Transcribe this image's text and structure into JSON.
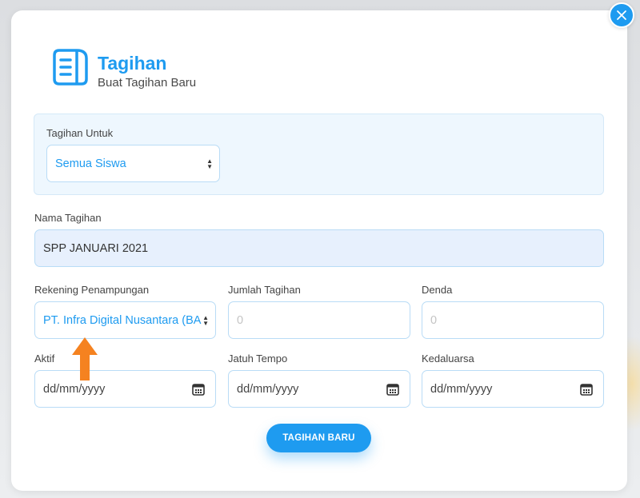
{
  "header": {
    "title": "Tagihan",
    "subtitle": "Buat Tagihan Baru",
    "icon": "document-icon"
  },
  "form": {
    "tagihan_untuk": {
      "label": "Tagihan Untuk",
      "value": "Semua Siswa"
    },
    "nama_tagihan": {
      "label": "Nama Tagihan",
      "value": "SPP JANUARI 2021"
    },
    "rekening": {
      "label": "Rekening Penampungan",
      "value": "PT. Infra Digital Nusantara (BA"
    },
    "jumlah": {
      "label": "Jumlah Tagihan",
      "placeholder": "0"
    },
    "denda": {
      "label": "Denda",
      "placeholder": "0"
    },
    "aktif": {
      "label": "Aktif",
      "placeholder": "dd/mm/yyyy"
    },
    "jatuh_tempo": {
      "label": "Jatuh Tempo",
      "placeholder": "dd/mm/yyyy"
    },
    "kedaluarsa": {
      "label": "Kedaluarsa",
      "placeholder": "dd/mm/yyyy"
    },
    "submit_label": "TAGIHAN BARU"
  },
  "colors": {
    "accent": "#1e9bf0",
    "pointer": "#f58220"
  }
}
